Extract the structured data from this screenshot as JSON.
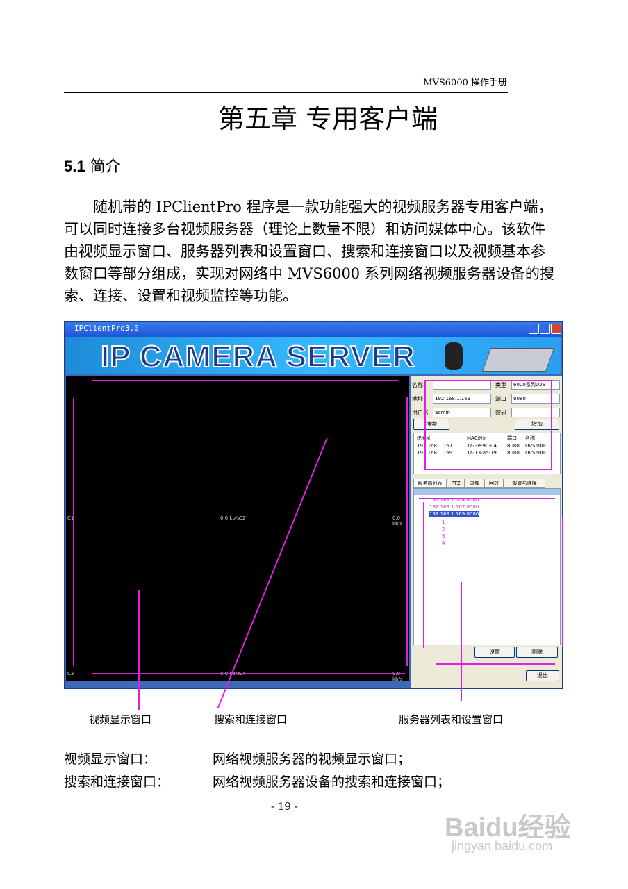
{
  "header": {
    "manual": "MVS6000 操作手册"
  },
  "chapter_title": "第五章 专用客户端",
  "section": {
    "number": "5.1",
    "title": "简介"
  },
  "intro": "随机带的 IPClientPro 程序是一款功能强大的视频服务器专用客户端，可以同时连接多台视频服务器（理论上数量不限）和访问媒体中心。该软件由视频显示窗口、服务器列表和设置窗口、搜索和连接窗口以及视频基本参数窗口等部分组成，实现对网络中 MVS6000 系列网络视频服务器设备的搜索、连接、设置和视频监控等功能。",
  "app": {
    "title": "IPClientPro3.0",
    "banner": "IP CAMERA SERVER",
    "video_labels": {
      "c1": "C1",
      "c2": "C2",
      "c3": "C3",
      "c4": "C4",
      "rate": "0.0 kb/s"
    },
    "fields": {
      "name_label": "名称",
      "name_value": "",
      "type_label": "类型",
      "type_value": "6000系列DVS",
      "addr_label": "地址",
      "addr_value": "192.168.1.169",
      "port_label": "端口",
      "port_value": "8080",
      "user_label": "用户名",
      "user_value": "admin",
      "pass_label": "密码",
      "pass_value": ""
    },
    "search_button": "搜索",
    "add_button": "增加",
    "table": {
      "headers": [
        "IP地址",
        "MAC地址",
        "端口",
        "名称"
      ],
      "rows": [
        [
          "192.168.1.167",
          "1a-3e-90-04...",
          "8080",
          "DVS6000"
        ],
        [
          "192.168.1.169",
          "1a-13-a5-19...",
          "8080",
          "DVS6000"
        ]
      ]
    },
    "tabs": [
      "服务器列表",
      "PTZ",
      "录像",
      "回放",
      "报警与连接"
    ],
    "tree": {
      "servers": [
        "192.168.1.104:8080",
        "192.168.1.167:8080",
        "192.168.1.169:8080"
      ],
      "channels": [
        "1",
        "2",
        "3",
        "4"
      ]
    },
    "settings_button": "设置",
    "delete_button": "删除",
    "exit_button": "退出"
  },
  "captions": {
    "video": "视频显示窗口",
    "search": "搜索和连接窗口",
    "server": "服务器列表和设置窗口"
  },
  "definitions": [
    {
      "term": "视频显示窗口：",
      "desc": "网络视频服务器的视频显示窗口；"
    },
    {
      "term": "搜索和连接窗口：",
      "desc": "网络视频服务器设备的搜索和连接窗口；"
    }
  ],
  "page_number": "- 19 -",
  "watermark": {
    "logo": "Baidu经验",
    "url": "jingyan.baidu.com"
  },
  "colors": {
    "annotation": "#e020e0",
    "video_bg": "#000000",
    "banner": "#35b8ff"
  }
}
